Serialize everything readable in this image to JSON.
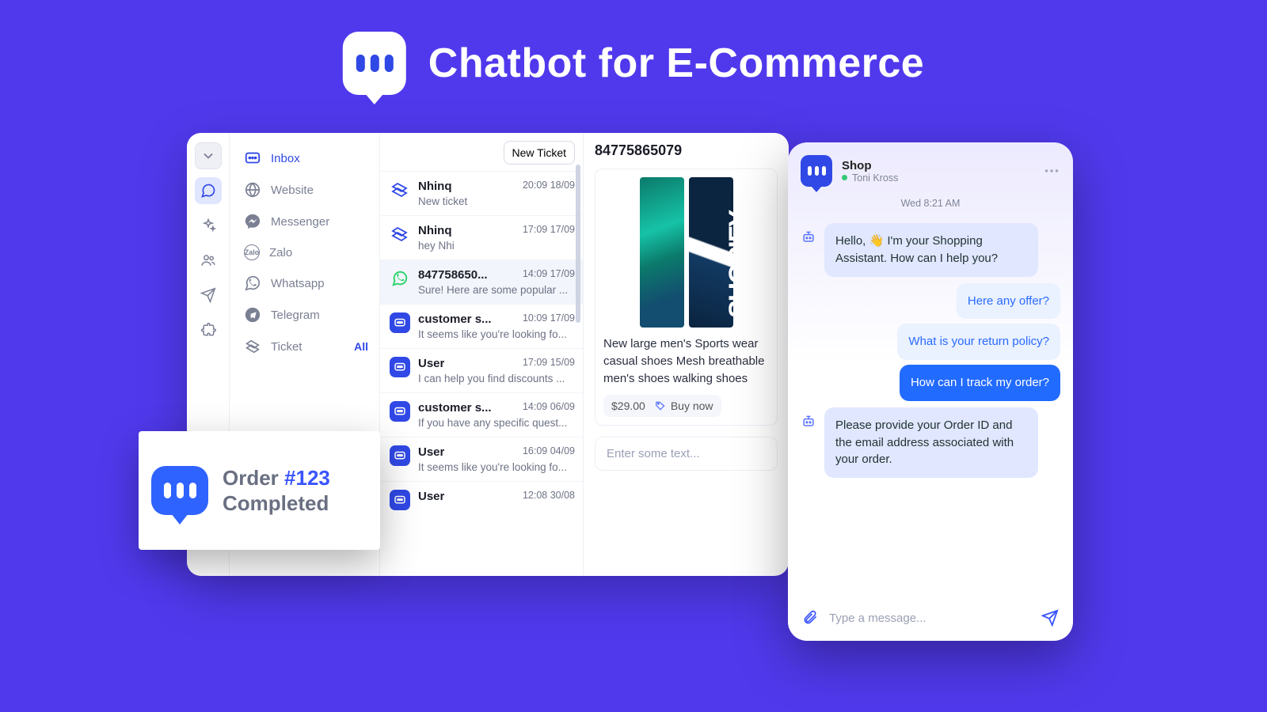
{
  "hero": {
    "title": "Chatbot for E-Commerce"
  },
  "dashboard": {
    "channels": {
      "inbox": "Inbox",
      "website": "Website",
      "messenger": "Messenger",
      "zalo": "Zalo",
      "whatsapp": "Whatsapp",
      "telegram": "Telegram",
      "ticket": "Ticket",
      "ticket_filter": "All"
    },
    "tickets": {
      "new_button": "New Ticket",
      "items": [
        {
          "name": "Nhinq",
          "time": "20:09 18/09",
          "preview": "New ticket",
          "icon": "tag"
        },
        {
          "name": "Nhinq",
          "time": "17:09 17/09",
          "preview": "hey Nhi",
          "icon": "tag"
        },
        {
          "name": "847758650...",
          "time": "14:09 17/09",
          "preview": "Sure! Here are some popular ...",
          "icon": "whatsapp",
          "selected": true
        },
        {
          "name": "customer s...",
          "time": "10:09 17/09",
          "preview": "It seems like you're looking fo...",
          "icon": "bot"
        },
        {
          "name": "User",
          "time": "17:09 15/09",
          "preview": "I can help you find discounts ...",
          "icon": "bot"
        },
        {
          "name": "customer s...",
          "time": "14:09 06/09",
          "preview": "If you have any specific quest...",
          "icon": "bot"
        },
        {
          "name": "User",
          "time": "16:09 04/09",
          "preview": "It seems like you're looking fo...",
          "icon": "bot"
        },
        {
          "name": "User",
          "time": "12:08 30/08",
          "preview": "",
          "icon": "bot"
        }
      ]
    },
    "detail": {
      "title": "84775865079",
      "product_name": "New large men's Sports wear casual shoes Mesh breathable men's shoes walking shoes",
      "product_brand_art": "SHOPIFY",
      "price": "$29.00",
      "buy_label": "Buy now",
      "composer_placeholder": "Enter some text..."
    }
  },
  "order_card": {
    "prefix": "Order ",
    "order_no": "#123",
    "status": "Completed"
  },
  "widget": {
    "shop": "Shop",
    "agent": "Toni Kross",
    "timestamp": "Wed 8:21 AM",
    "bot_greeting": "Hello, 👋 I'm your Shopping Assistant. How can I help you?",
    "user_q1": "Here any offer?",
    "user_q2": "What is your return policy?",
    "user_q3": "How can I track my order?",
    "bot_reply": "Please provide your Order ID and the email address associated with your order.",
    "input_placeholder": "Type a message..."
  }
}
